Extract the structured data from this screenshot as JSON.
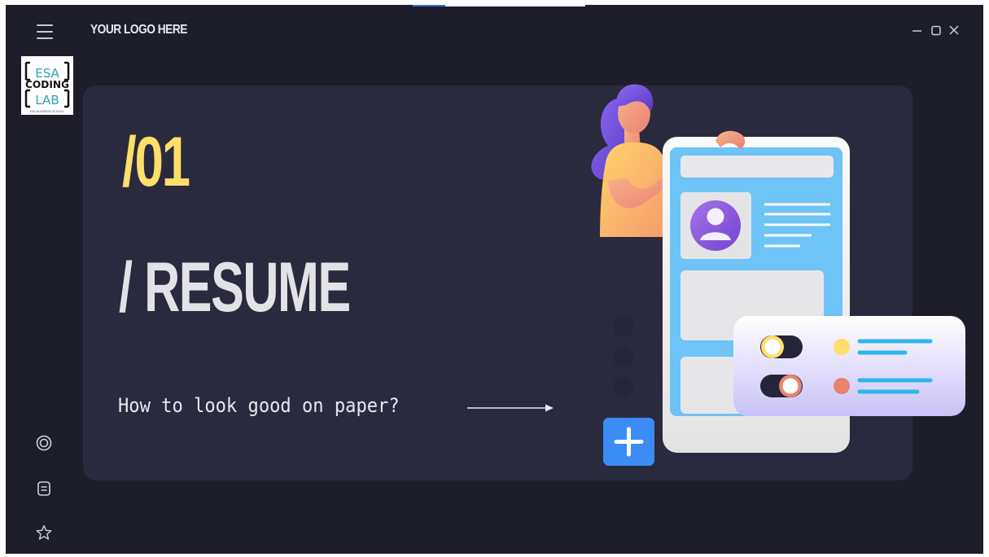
{
  "window": {
    "brand_text": "YOUR LOGO HERE",
    "controls": [
      "minimize",
      "maximize",
      "close"
    ]
  },
  "logo": {
    "line1": "ESA",
    "line2": "CODING",
    "line3": "LAB",
    "caption": "ESA BUSINESS SCHOOL"
  },
  "hero": {
    "number": "/01",
    "title": "/ RESUME",
    "subtitle": "How to look good on paper?"
  },
  "sidebar": {
    "icons": [
      "target-icon",
      "document-icon",
      "star-icon"
    ]
  },
  "colors": {
    "background": "#1e1e2a",
    "card": "#2a2a3e",
    "accent_yellow": "#ffde6a",
    "accent_blue": "#3b8cf5",
    "phone_blue": "#6ec3f7"
  }
}
